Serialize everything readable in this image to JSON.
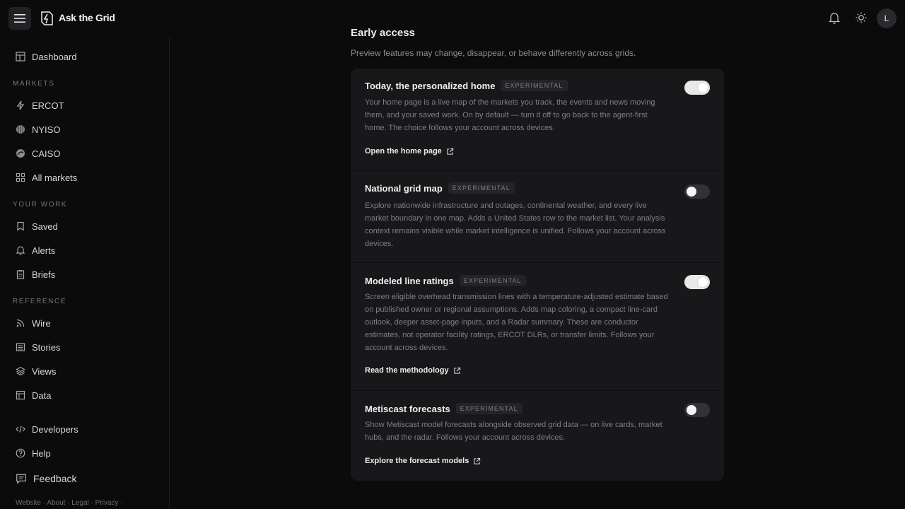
{
  "app": {
    "brand": "Ask the Grid",
    "avatar_initial": "L"
  },
  "sidebar": {
    "dashboard": "Dashboard",
    "markets_label": "MARKETS",
    "markets": [
      "ERCOT",
      "NYISO",
      "CAISO",
      "All markets"
    ],
    "work_label": "YOUR WORK",
    "work": [
      "Saved",
      "Alerts",
      "Briefs"
    ],
    "reference_label": "REFERENCE",
    "reference": [
      "Wire",
      "Stories",
      "Views",
      "Data"
    ],
    "developers": "Developers",
    "help": "Help",
    "feedback": "Feedback",
    "footer": "Website · About · Legal · Privacy ·"
  },
  "section": {
    "title": "Early access",
    "description": "Preview features may change, disappear, or behave differently across grids."
  },
  "features": [
    {
      "title": "Today, the personalized home",
      "badge": "EXPERIMENTAL",
      "description": "Your home page is a live map of the markets you track, the events and news moving them, and your saved work. On by default — turn it off to go back to the agent-first home. The choice follows your account across devices.",
      "link": "Open the home page",
      "enabled": true
    },
    {
      "title": "National grid map",
      "badge": "EXPERIMENTAL",
      "description": "Explore nationwide infrastructure and outages, continental weather, and every live market boundary in one map. Adds a United States row to the market list. Your analysis context remains visible while market intelligence is unified. Follows your account across devices.",
      "link": "",
      "enabled": false
    },
    {
      "title": "Modeled line ratings",
      "badge": "EXPERIMENTAL",
      "description": "Screen eligible overhead transmission lines with a temperature-adjusted estimate based on published owner or regional assumptions. Adds map coloring, a compact line-card outlook, deeper asset-page inputs, and a Radar summary. These are conductor estimates, not operator facility ratings, ERCOT DLRs, or transfer limits. Follows your account across devices.",
      "link": "Read the methodology",
      "enabled": true
    },
    {
      "title": "Metiscast forecasts",
      "badge": "EXPERIMENTAL",
      "description": "Show Metiscast model forecasts alongside observed grid data — on live cards, market hubs, and the radar. Follows your account across devices.",
      "link": "Explore the forecast models",
      "enabled": false
    }
  ]
}
